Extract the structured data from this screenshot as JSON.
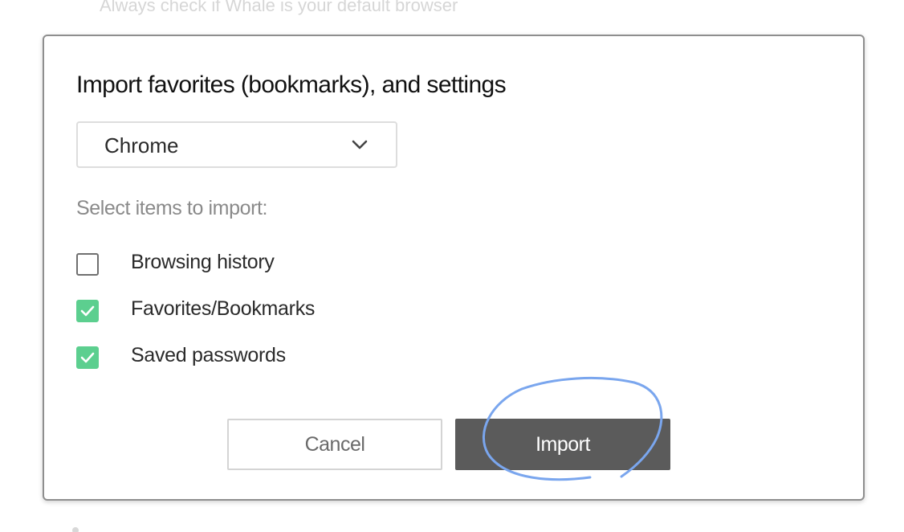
{
  "background": {
    "hint_text": "Always check if Whale is your default browser"
  },
  "dialog": {
    "title": "Import favorites (bookmarks), and settings",
    "source_select": {
      "selected": "Chrome"
    },
    "section_label": "Select items to import:",
    "options": [
      {
        "label": "Browsing history",
        "checked": false
      },
      {
        "label": "Favorites/Bookmarks",
        "checked": true
      },
      {
        "label": "Saved passwords",
        "checked": true
      }
    ],
    "buttons": {
      "cancel_label": "Cancel",
      "import_label": "Import"
    }
  },
  "colors": {
    "checkbox_checked": "#5ccf8f",
    "import_button": "#5b5b5b",
    "annotation_stroke": "#7aa6ee"
  },
  "annotation": {
    "type": "hand-drawn circle",
    "target": "import-button"
  }
}
